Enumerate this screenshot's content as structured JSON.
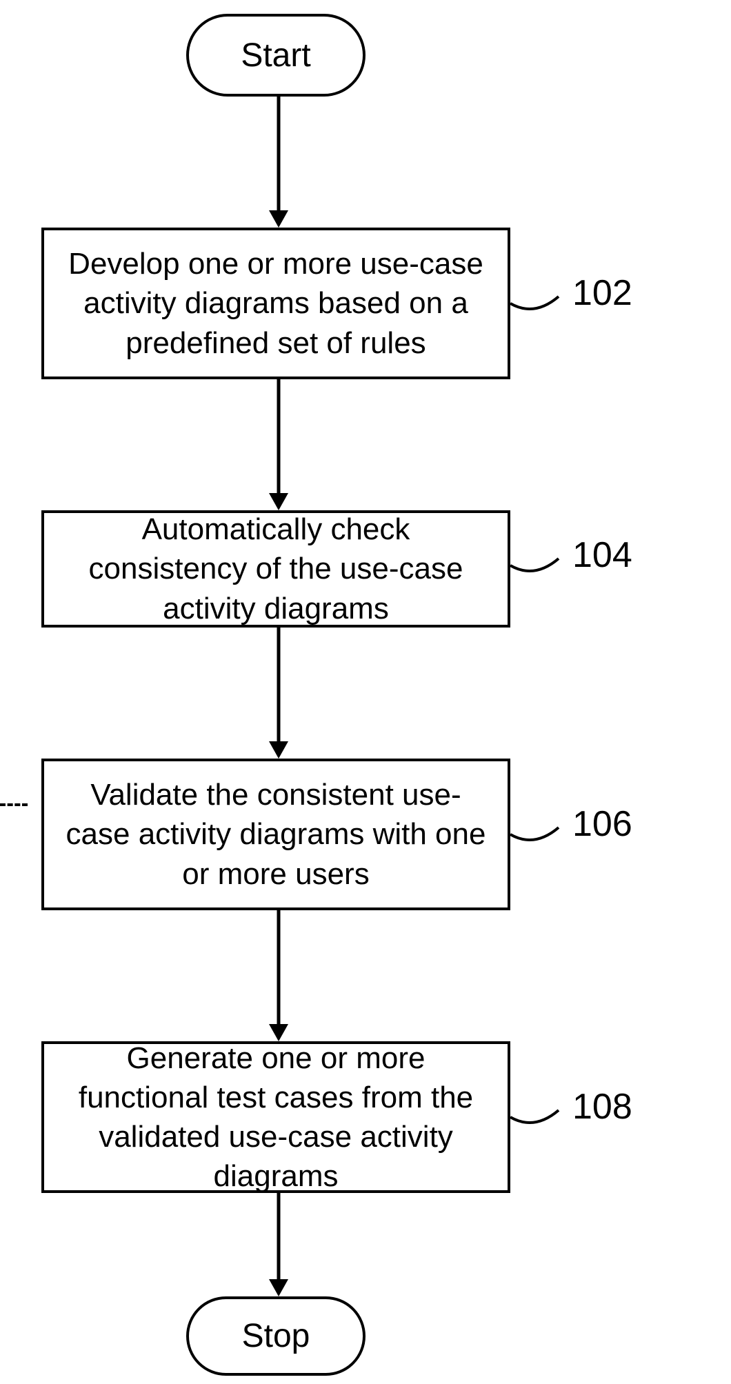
{
  "nodes": {
    "start": {
      "text": "Start"
    },
    "step102": {
      "text": "Develop one or more use-case activity diagrams based on a predefined set of rules",
      "label": "102"
    },
    "step104": {
      "text": "Automatically check consistency of the use-case activity diagrams",
      "label": "104"
    },
    "step106": {
      "text": "Validate the consistent use-case activity diagrams with one or more users",
      "label": "106"
    },
    "step108": {
      "text": "Generate one or more functional test cases from the validated use-case activity diagrams",
      "label": "108"
    },
    "stop": {
      "text": "Stop"
    }
  }
}
